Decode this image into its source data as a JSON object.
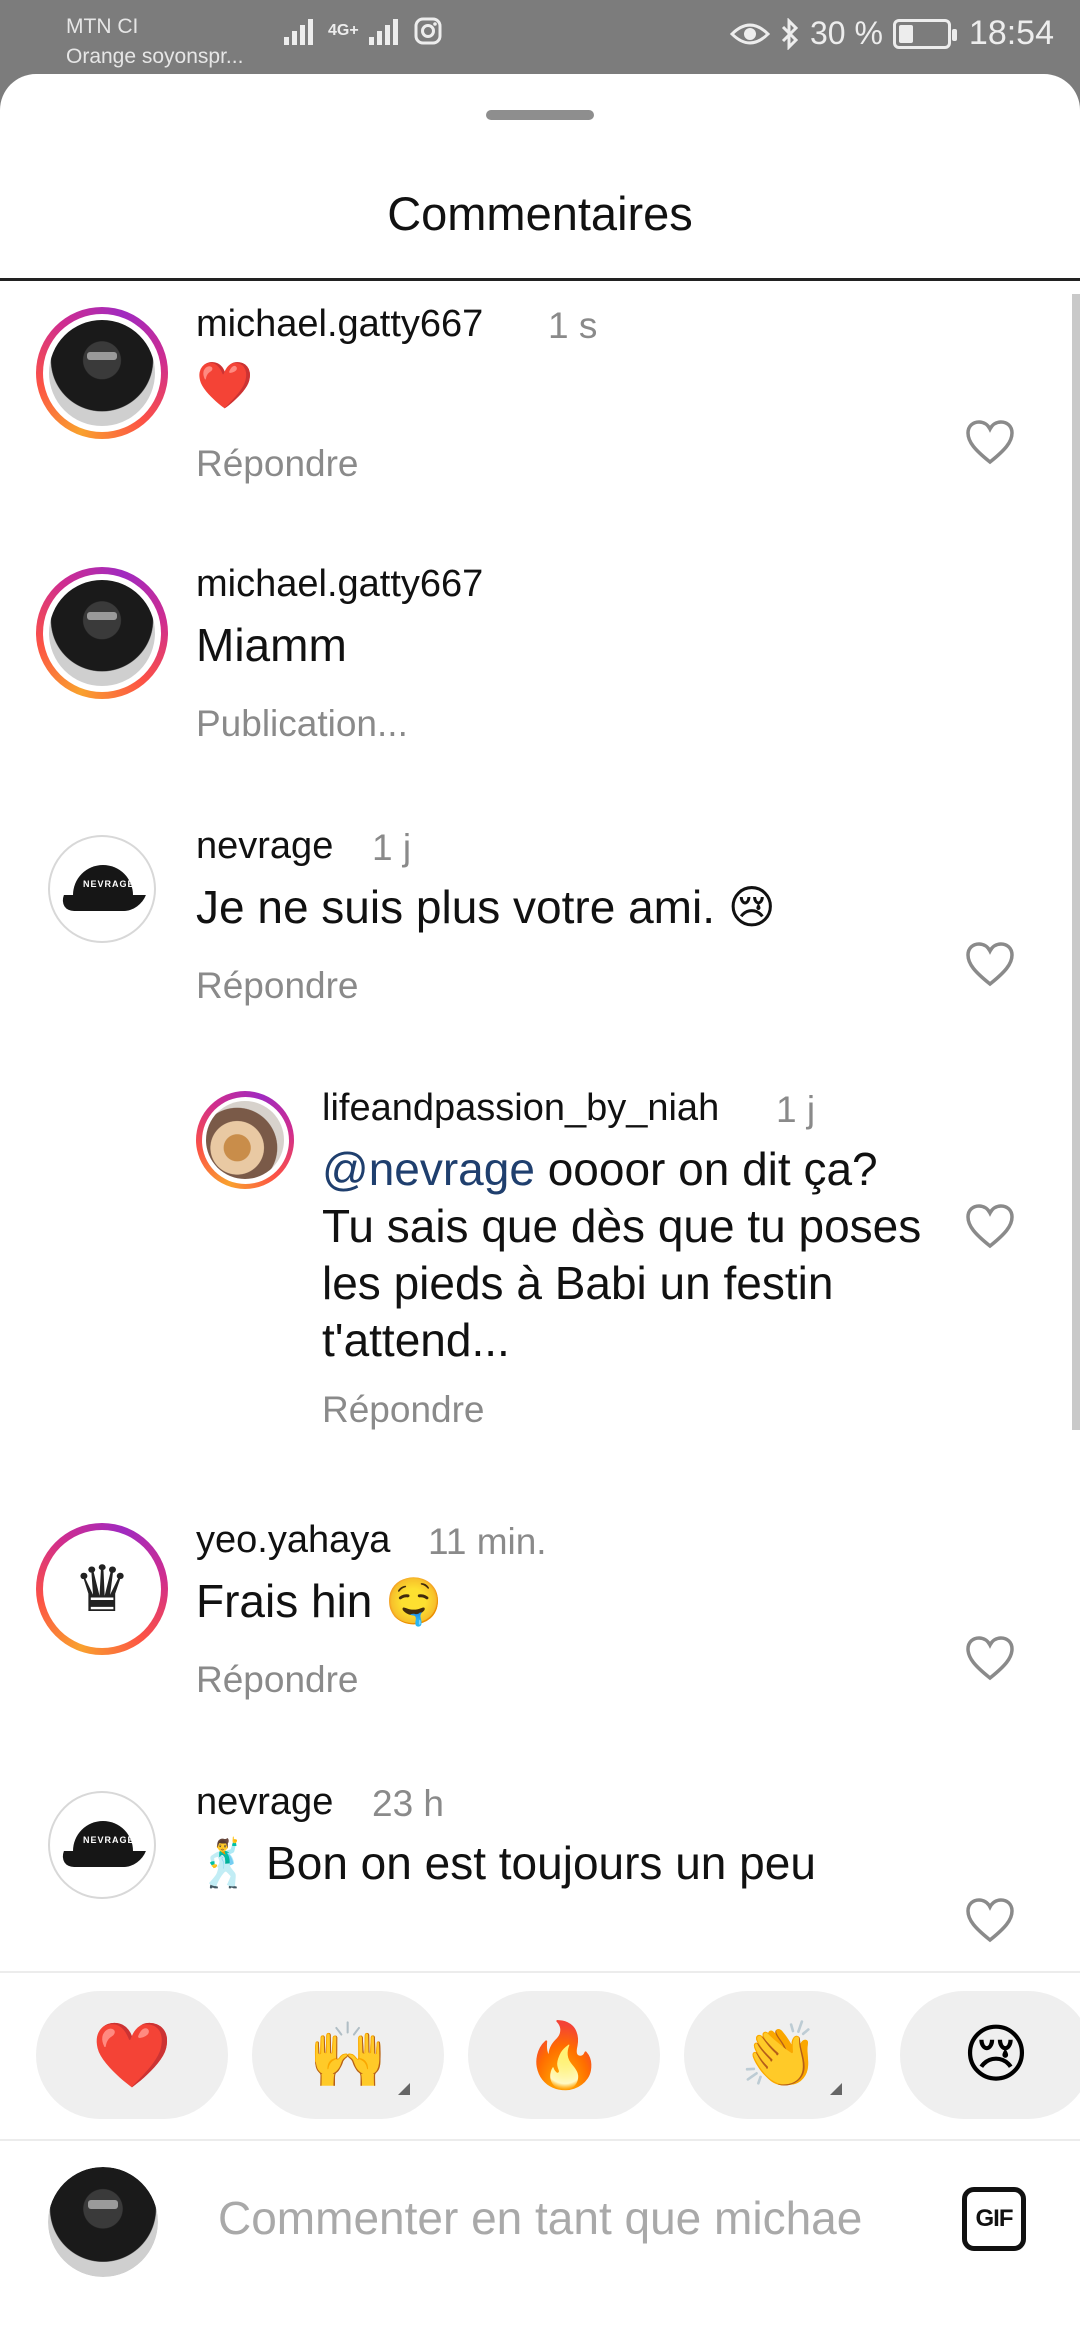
{
  "status_bar": {
    "carrier_1": "MTN CI",
    "carrier_2": "Orange soyonspr...",
    "network": "4G+",
    "battery": "30 %",
    "time": "18:54"
  },
  "sheet": {
    "title": "Commentaires"
  },
  "comments": [
    {
      "username": "michael.gatty667",
      "time": "1 s",
      "text": "❤️",
      "action": "Répondre"
    },
    {
      "username": "michael.gatty667",
      "time": "",
      "text": "Miamm",
      "action": "Publication..."
    },
    {
      "username": "nevrage",
      "time": "1 j",
      "text": "Je ne suis plus votre ami. 😢",
      "action": "Répondre"
    },
    {
      "username": "lifeandpassion_by_niah",
      "time": "1 j",
      "mention": "@nevrage",
      "text": " oooor on dit ça? Tu sais que dès que tu poses les pieds à Babi un festin t'attend...",
      "action": "Répondre"
    },
    {
      "username": "yeo.yahaya",
      "time": "11 min.",
      "text": "Frais hin 🤤",
      "action": "Répondre"
    },
    {
      "username": "nevrage",
      "time": "23 h",
      "text": "🕺 Bon on est toujours un peu"
    }
  ],
  "avatar_text": {
    "cap_brand": "NEVRAGE"
  },
  "reactions": [
    "❤️",
    "🙌",
    "🔥",
    "👏",
    "😢"
  ],
  "composer": {
    "placeholder": "Commenter en tant que michae",
    "gif_label": "GIF"
  },
  "colors": {
    "mention": "#1f3f6e",
    "secondary_text": "#8a8a8a",
    "heart_red": "#e0202c"
  }
}
